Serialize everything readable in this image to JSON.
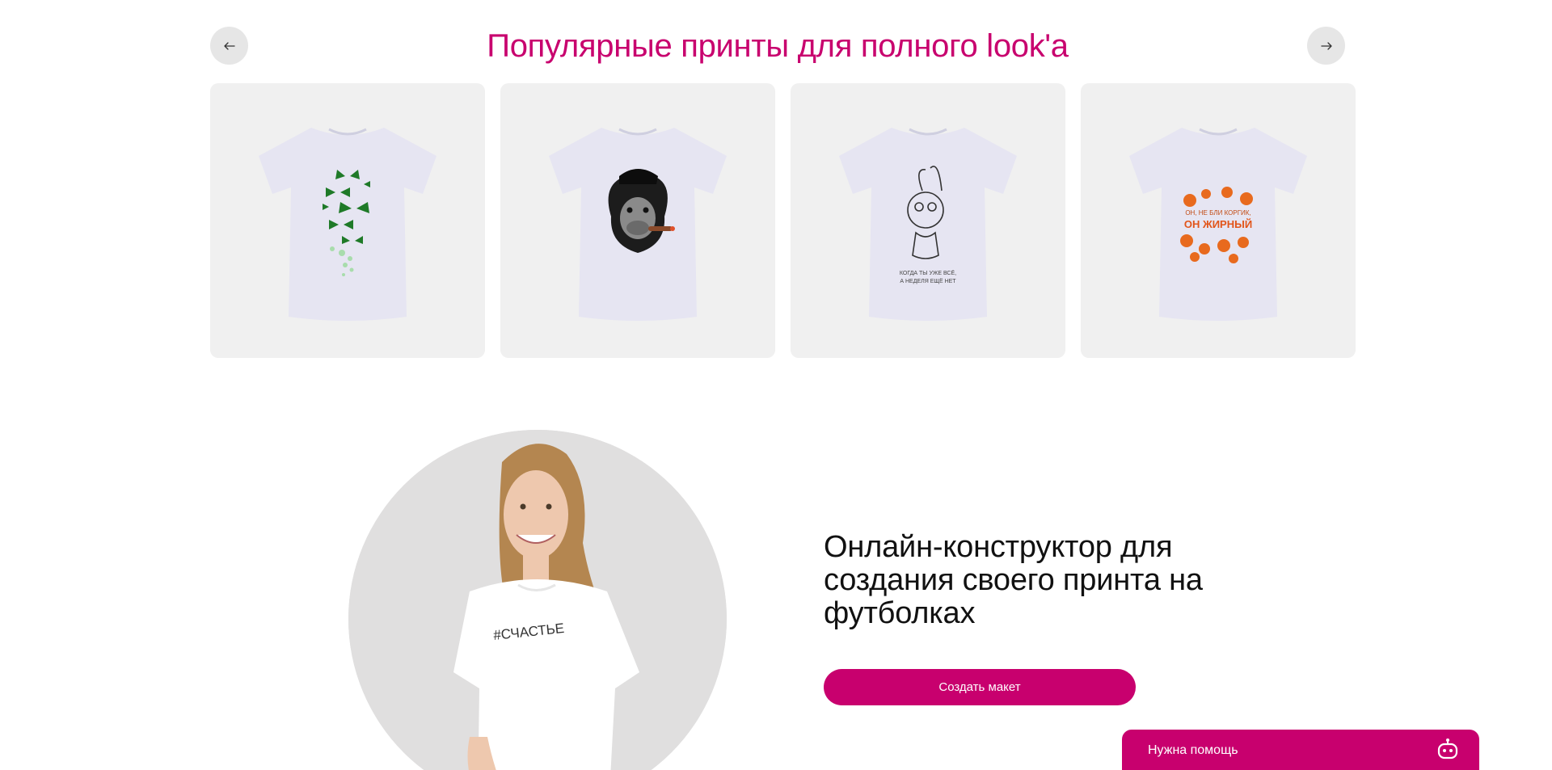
{
  "colors": {
    "accent": "#c8006e",
    "card_bg": "#f0f0f0",
    "nav_bg": "#e6e6e6",
    "tshirt": "#e6e5f2"
  },
  "carousel": {
    "title": "Популярные принты для полного look'a",
    "prev_icon": "arrow-left-icon",
    "next_icon": "arrow-right-icon",
    "items": [
      {
        "print": "green-butterflies",
        "caption": ""
      },
      {
        "print": "monkey-with-cigar",
        "caption": ""
      },
      {
        "print": "hare-with-text",
        "caption": "КОГДА ТЫ УЖЕ ВСЁ, А НЕДЕЛЯ ЕЩЁ НЕТ"
      },
      {
        "print": "foxes-with-text",
        "caption": "ОН, НЕ БЛИ КОРГИК, ОН ЖИРНЫЙ"
      }
    ]
  },
  "promo": {
    "title": "Онлайн-конструктор для создания своего принта на футболках",
    "shirt_text": "#СЧАСТЬЕ",
    "cta_label": "Создать макет"
  },
  "help": {
    "label": "Нужна помощь",
    "icon": "robot-icon"
  }
}
